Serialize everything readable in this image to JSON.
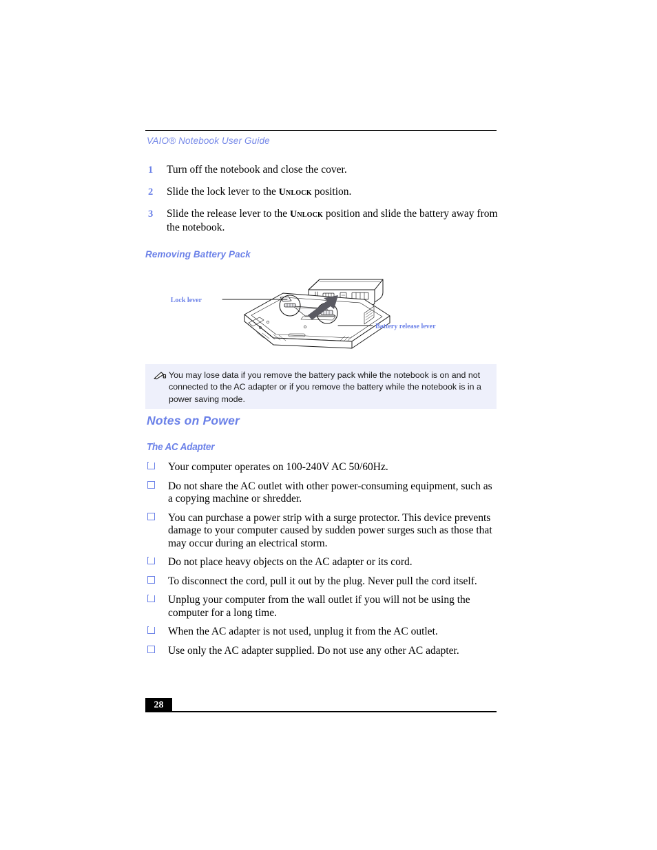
{
  "document": {
    "running_header": "VAIO® Notebook User Guide",
    "page_number": "28"
  },
  "steps": [
    {
      "num": "1",
      "text_before": "Turn off the notebook and close the cover.",
      "smallcaps": "",
      "text_after": ""
    },
    {
      "num": "2",
      "text_before": "Slide the lock lever to the ",
      "smallcaps": "Unlock",
      "text_after": " position."
    },
    {
      "num": "3",
      "text_before": "Slide the release lever to the ",
      "smallcaps": "Unlock",
      "text_after": " position and slide the battery away from the notebook."
    }
  ],
  "figure": {
    "heading": "Removing Battery Pack",
    "labels": {
      "lock_lever": "Lock lever",
      "battery_release_lever": "Battery release lever"
    },
    "alt": "Underside of notebook with battery pack being slid away; lock lever and battery release lever circled"
  },
  "note": {
    "icon": "pencil-note-icon",
    "text": "You may lose data if you remove the battery pack while the notebook is on and not connected to the AC adapter or if you remove the battery while the notebook is in a power saving mode."
  },
  "section": {
    "title": "Notes on Power",
    "subtitle": "The AC Adapter",
    "bullets": [
      "Your computer operates on 100-240V AC 50/60Hz.",
      "Do not share the AC outlet with other power-consuming equipment, such as a copying machine or shredder.",
      "You can purchase a power strip with a surge protector. This device prevents damage to your computer caused by sudden power surges such as those that may occur during an electrical storm.",
      "Do not place heavy objects on the AC adapter or its cord.",
      "To disconnect the cord, pull it out by the plug. Never pull the cord itself.",
      "Unplug your computer from the wall outlet if you will not be using the computer for a long time.",
      "When the AC adapter is not used, unplug it from the AC outlet.",
      "Use only the AC adapter supplied. Do not use any other AC adapter."
    ]
  },
  "colors": {
    "accent_blue": "#6b81e8",
    "header_blue": "#7689e8",
    "note_background": "#eef0fb",
    "body_text": "#000000",
    "rule": "#000000"
  }
}
